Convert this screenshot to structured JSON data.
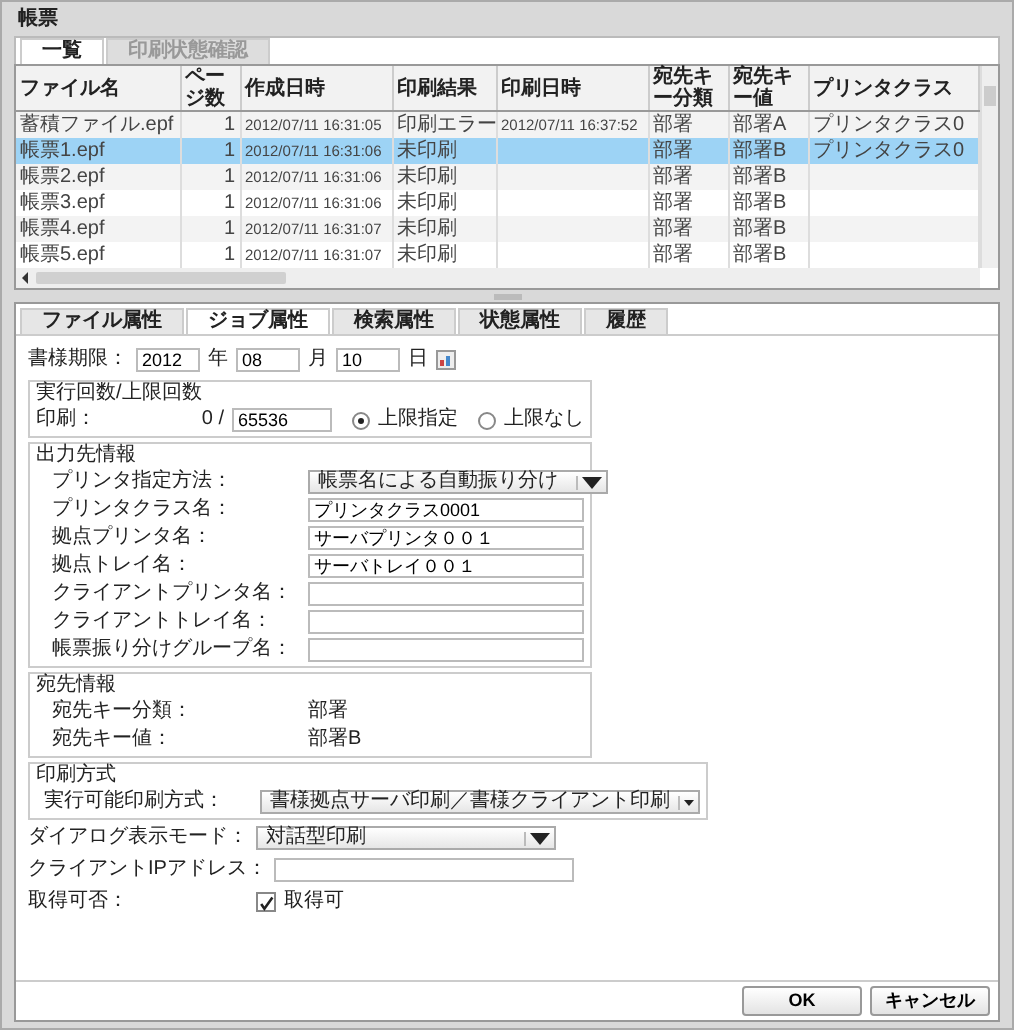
{
  "window": {
    "title": "帳票"
  },
  "tabs": [
    {
      "label": "一覧",
      "selected": true
    },
    {
      "label": "印刷状態確認",
      "selected": false
    }
  ],
  "table": {
    "columns": [
      "ファイル名",
      "ページ数",
      "作成日時",
      "印刷結果",
      "印刷日時",
      "宛先キー分類",
      "宛先キー値",
      "プリンタクラス"
    ],
    "rows": [
      {
        "file": "蓄積ファイル.epf",
        "pages": "1",
        "created": "2012/07/11 16:31:05",
        "result": "印刷エラー",
        "printed": "2012/07/11 16:37:52",
        "key_class": "部署",
        "key_value": "部署A",
        "printer_class": "プリンタクラス0",
        "selected": false
      },
      {
        "file": "帳票1.epf",
        "pages": "1",
        "created": "2012/07/11 16:31:06",
        "result": "未印刷",
        "key_class": "部署",
        "key_value": "部署B",
        "printer_class": "プリンタクラス0",
        "selected": true
      },
      {
        "file": "帳票2.epf",
        "pages": "1",
        "created": "2012/07/11 16:31:06",
        "result": "未印刷",
        "key_class": "部署",
        "key_value": "部署B",
        "selected": false
      },
      {
        "file": "帳票3.epf",
        "pages": "1",
        "created": "2012/07/11 16:31:06",
        "result": "未印刷",
        "key_class": "部署",
        "key_value": "部署B",
        "selected": false
      },
      {
        "file": "帳票4.epf",
        "pages": "1",
        "created": "2012/07/11 16:31:07",
        "result": "未印刷",
        "key_class": "部署",
        "key_value": "部署B",
        "selected": false
      },
      {
        "file": "帳票5.epf",
        "pages": "1",
        "created": "2012/07/11 16:31:07",
        "result": "未印刷",
        "key_class": "部署",
        "key_value": "部署B",
        "selected": false
      }
    ]
  },
  "detail_tabs": [
    {
      "label": "ファイル属性",
      "selected": false
    },
    {
      "label": "ジョブ属性",
      "selected": true
    },
    {
      "label": "検索属性",
      "selected": false
    },
    {
      "label": "状態属性",
      "selected": false
    },
    {
      "label": "履歴",
      "selected": false
    }
  ],
  "deadline": {
    "label": "書様期限：",
    "year": "2012",
    "year_unit": "年",
    "month": "08",
    "month_unit": "月",
    "day": "10",
    "day_unit": "日"
  },
  "print_count": {
    "title": "実行回数/上限回数",
    "label": "印刷：",
    "count": "0 /",
    "limit": "65536",
    "options": [
      {
        "label": "上限指定",
        "selected": true
      },
      {
        "label": "上限なし",
        "selected": false
      }
    ]
  },
  "output": {
    "title": "出力先情報",
    "fields": [
      {
        "label": "プリンタ指定方法：",
        "kind": "select",
        "value": "帳票名による自動振り分け"
      },
      {
        "label": "プリンタクラス名：",
        "kind": "input",
        "value": "プリンタクラス0001"
      },
      {
        "label": "拠点プリンタ名：",
        "kind": "input",
        "value": "サーバプリンタ００１"
      },
      {
        "label": "拠点トレイ名：",
        "kind": "input",
        "value": "サーバトレイ００１"
      },
      {
        "label": "クライアントプリンタ名：",
        "kind": "input"
      },
      {
        "label": "クライアントトレイ名：",
        "kind": "input"
      },
      {
        "label": "帳票振り分けグループ名：",
        "kind": "input"
      }
    ]
  },
  "destination": {
    "title": "宛先情報",
    "fields": [
      {
        "label": "宛先キー分類：",
        "kind": "text",
        "value": "部署"
      },
      {
        "label": "宛先キー値：",
        "kind": "text",
        "value": "部署B"
      }
    ]
  },
  "print_method": {
    "title": "印刷方式",
    "fields": [
      {
        "label": "実行可能印刷方式：",
        "kind": "select",
        "value": "書様拠点サーバ印刷／書様クライアント印刷"
      }
    ]
  },
  "extra_fields": [
    {
      "label": "ダイアログ表示モード：",
      "kind": "select",
      "value": "対話型印刷"
    },
    {
      "label": "クライアントIPアドレス：",
      "kind": "input"
    },
    {
      "label": "取得可否：",
      "kind": "checkbox",
      "text": "取得可",
      "checked": true
    }
  ],
  "buttons": [
    "OK",
    "キャンセル"
  ]
}
